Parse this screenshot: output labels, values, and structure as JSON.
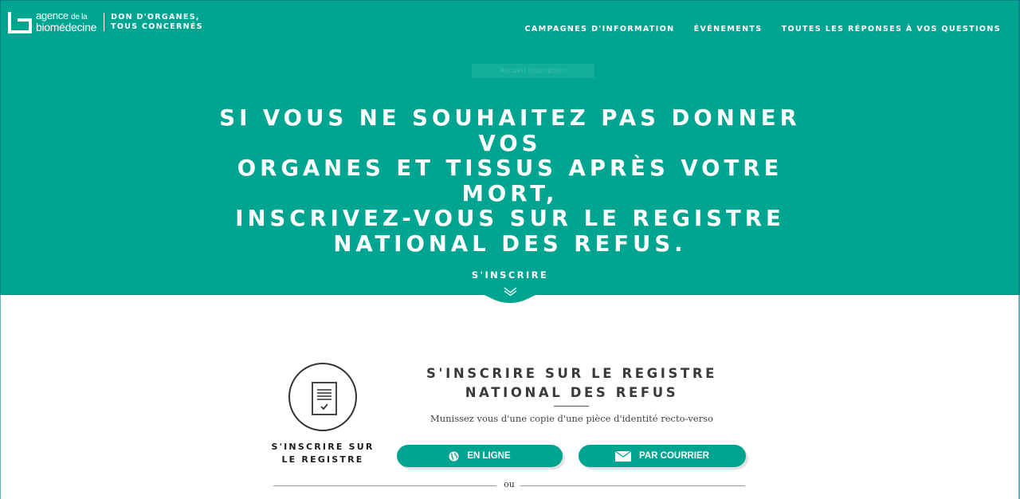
{
  "header": {
    "logo": {
      "line1": "agence",
      "line1_small": "de la",
      "line2": "biomédecine"
    },
    "tagline": [
      "DON D'ORGANES,",
      "TOUS CONCERNÉS"
    ],
    "nav": [
      "CAMPAGNES D'INFORMATION",
      "ÉVÉNEMENTS",
      "TOUTES LES RÉPONSES À VOS QUESTIONS"
    ]
  },
  "hero": {
    "breadcrumb": "Accueil  Inscription",
    "title_lines": [
      "SI VOUS NE SOUHAITEZ PAS DONNER VOS",
      "ORGANES ET TISSUS APRÈS VOTRE MORT,",
      "INSCRIVEZ-VOUS SUR LE REGISTRE",
      "NATIONAL DES REFUS."
    ],
    "cta": "S'INSCRIRE"
  },
  "card": {
    "left_label": [
      "S'INSCRIRE SUR",
      "LE REGISTRE"
    ],
    "title_lines": [
      "S'INSCRIRE SUR LE REGISTRE",
      "NATIONAL DES REFUS"
    ],
    "description": "Munissez vous d'une copie d'une pièce d'identité recto-verso",
    "btn_online": "EN LIGNE",
    "btn_mail": "PAR COURRIER",
    "separator": "ou"
  },
  "colors": {
    "primary": "#00a592",
    "text_dark": "#3a3a3a",
    "white": "#ffffff"
  },
  "icons": [
    "logo-mark-icon",
    "chevron-down-icon",
    "document-check-icon",
    "globe-icon",
    "envelope-icon"
  ]
}
